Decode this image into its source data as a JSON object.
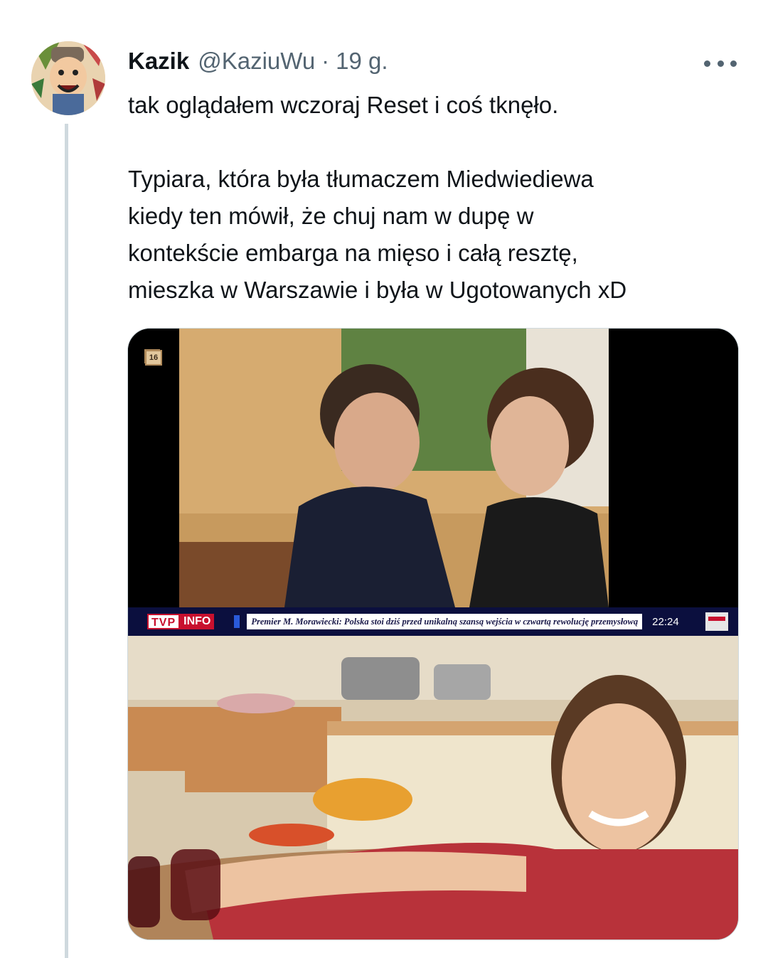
{
  "tweet": {
    "author_name": "Kazik",
    "author_handle": "@KaziuWu",
    "separator": "·",
    "time": "19 g.",
    "text": "tak oglądałem wczoraj Reset i coś tknęło.\n\nTypiara, która była tłumaczem Miedwiediewa\nkiedy ten mówił, że chuj nam w dupę w\nkontekście embarga na mięso i całą resztę,\nmieszka w Warszawie i była w Ugotowanych xD"
  },
  "media": {
    "tv_frame": {
      "age_badge": "16",
      "channel_logo_a": "TVP",
      "channel_logo_b": "INFO",
      "ticker_text": "Premier M. Morawiecki: Polska stoi dziś przed unikalną szansą wejścia w czwartą rewolucję przemysłową",
      "ticker_time": "22:24"
    }
  },
  "icons": {
    "more": "more-horizontal-icon",
    "avatar": "cartoon-avatar"
  },
  "colors": {
    "text_primary": "#0f1419",
    "text_secondary": "#536471",
    "border": "#cfd9de",
    "tvp_red": "#c8102e",
    "ticker_navy": "#0b0f3e"
  }
}
